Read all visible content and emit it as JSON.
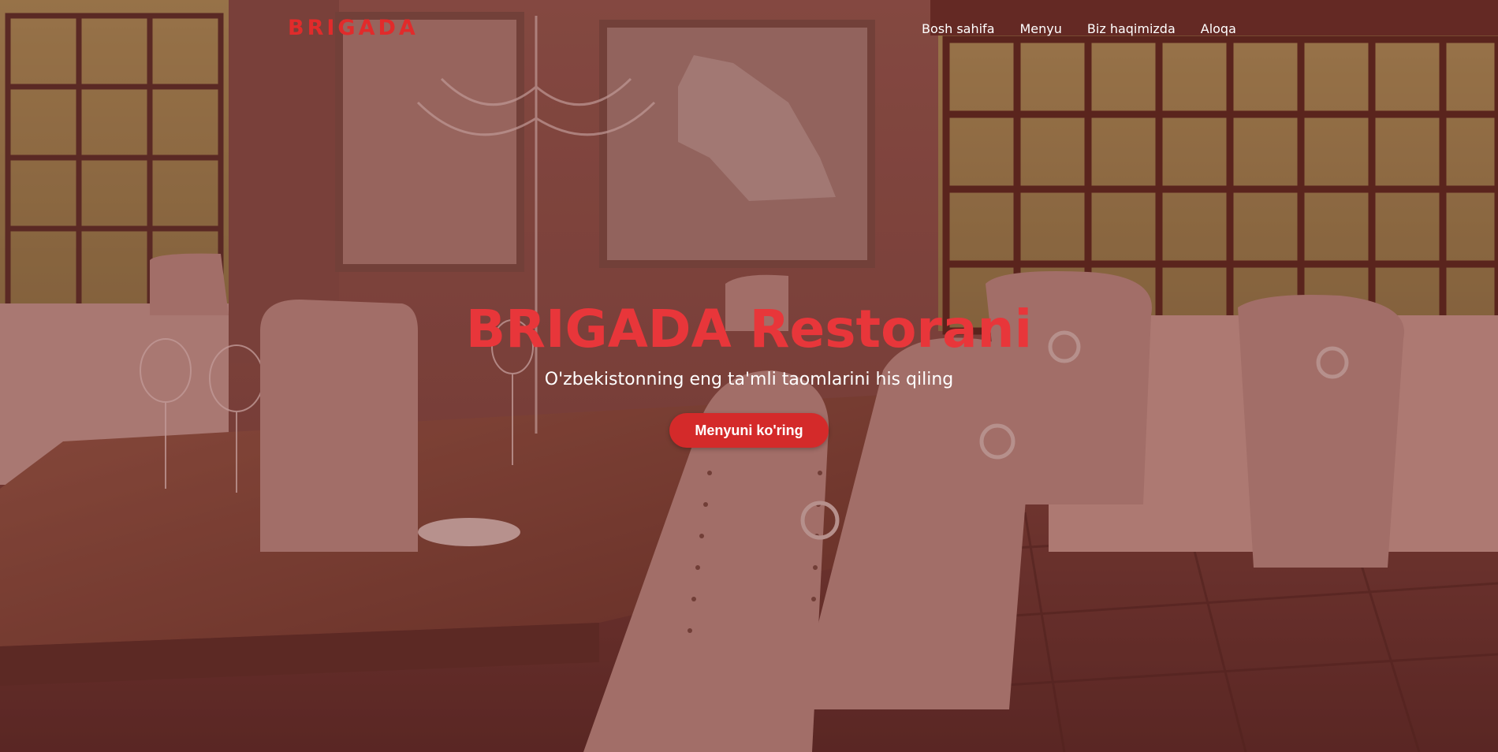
{
  "brand": {
    "logo_text": "BRIGADA",
    "accent_color": "#e12b2b"
  },
  "nav": {
    "items": [
      {
        "label": "Bosh sahifa"
      },
      {
        "label": "Menyu"
      },
      {
        "label": "Biz haqimizda"
      },
      {
        "label": "Aloqa"
      }
    ]
  },
  "hero": {
    "title": "BRIGADA Restorani",
    "subtitle": "O'zbekistonning eng ta'mli taomlarini his qiling",
    "cta_label": "Menyuni ko'ring",
    "background_image": "restaurant-dining-room-photo",
    "overlay_color": "#7a2828"
  }
}
